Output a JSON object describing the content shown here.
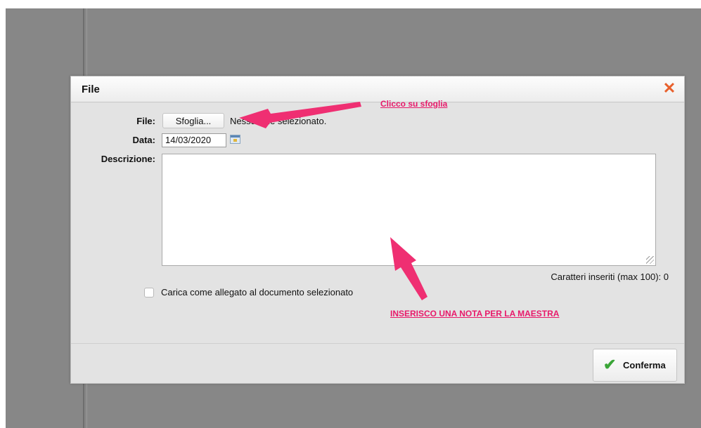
{
  "dialog": {
    "title": "File",
    "close_icon": "close-icon",
    "file_label": "File:",
    "browse_button": "Sfoglia...",
    "no_file_text": "Nessun file selezionato.",
    "date_label": "Data:",
    "date_value": "14/03/2020",
    "calendar_icon": "calendar-icon",
    "description_label": "Descrizione:",
    "description_value": "",
    "counter_text": "Caratteri inseriti (max 100): 0",
    "checkbox_label": "Carica come allegato al documento selezionato",
    "checkbox_checked": false,
    "confirm_button": "Conferma",
    "confirm_icon": "checkmark-icon"
  },
  "annotations": {
    "browse_note": "Clicco su sfoglia",
    "description_note": "INSERISCO UNA NOTA PER LA MAESTRA",
    "color": "#e8196a"
  }
}
